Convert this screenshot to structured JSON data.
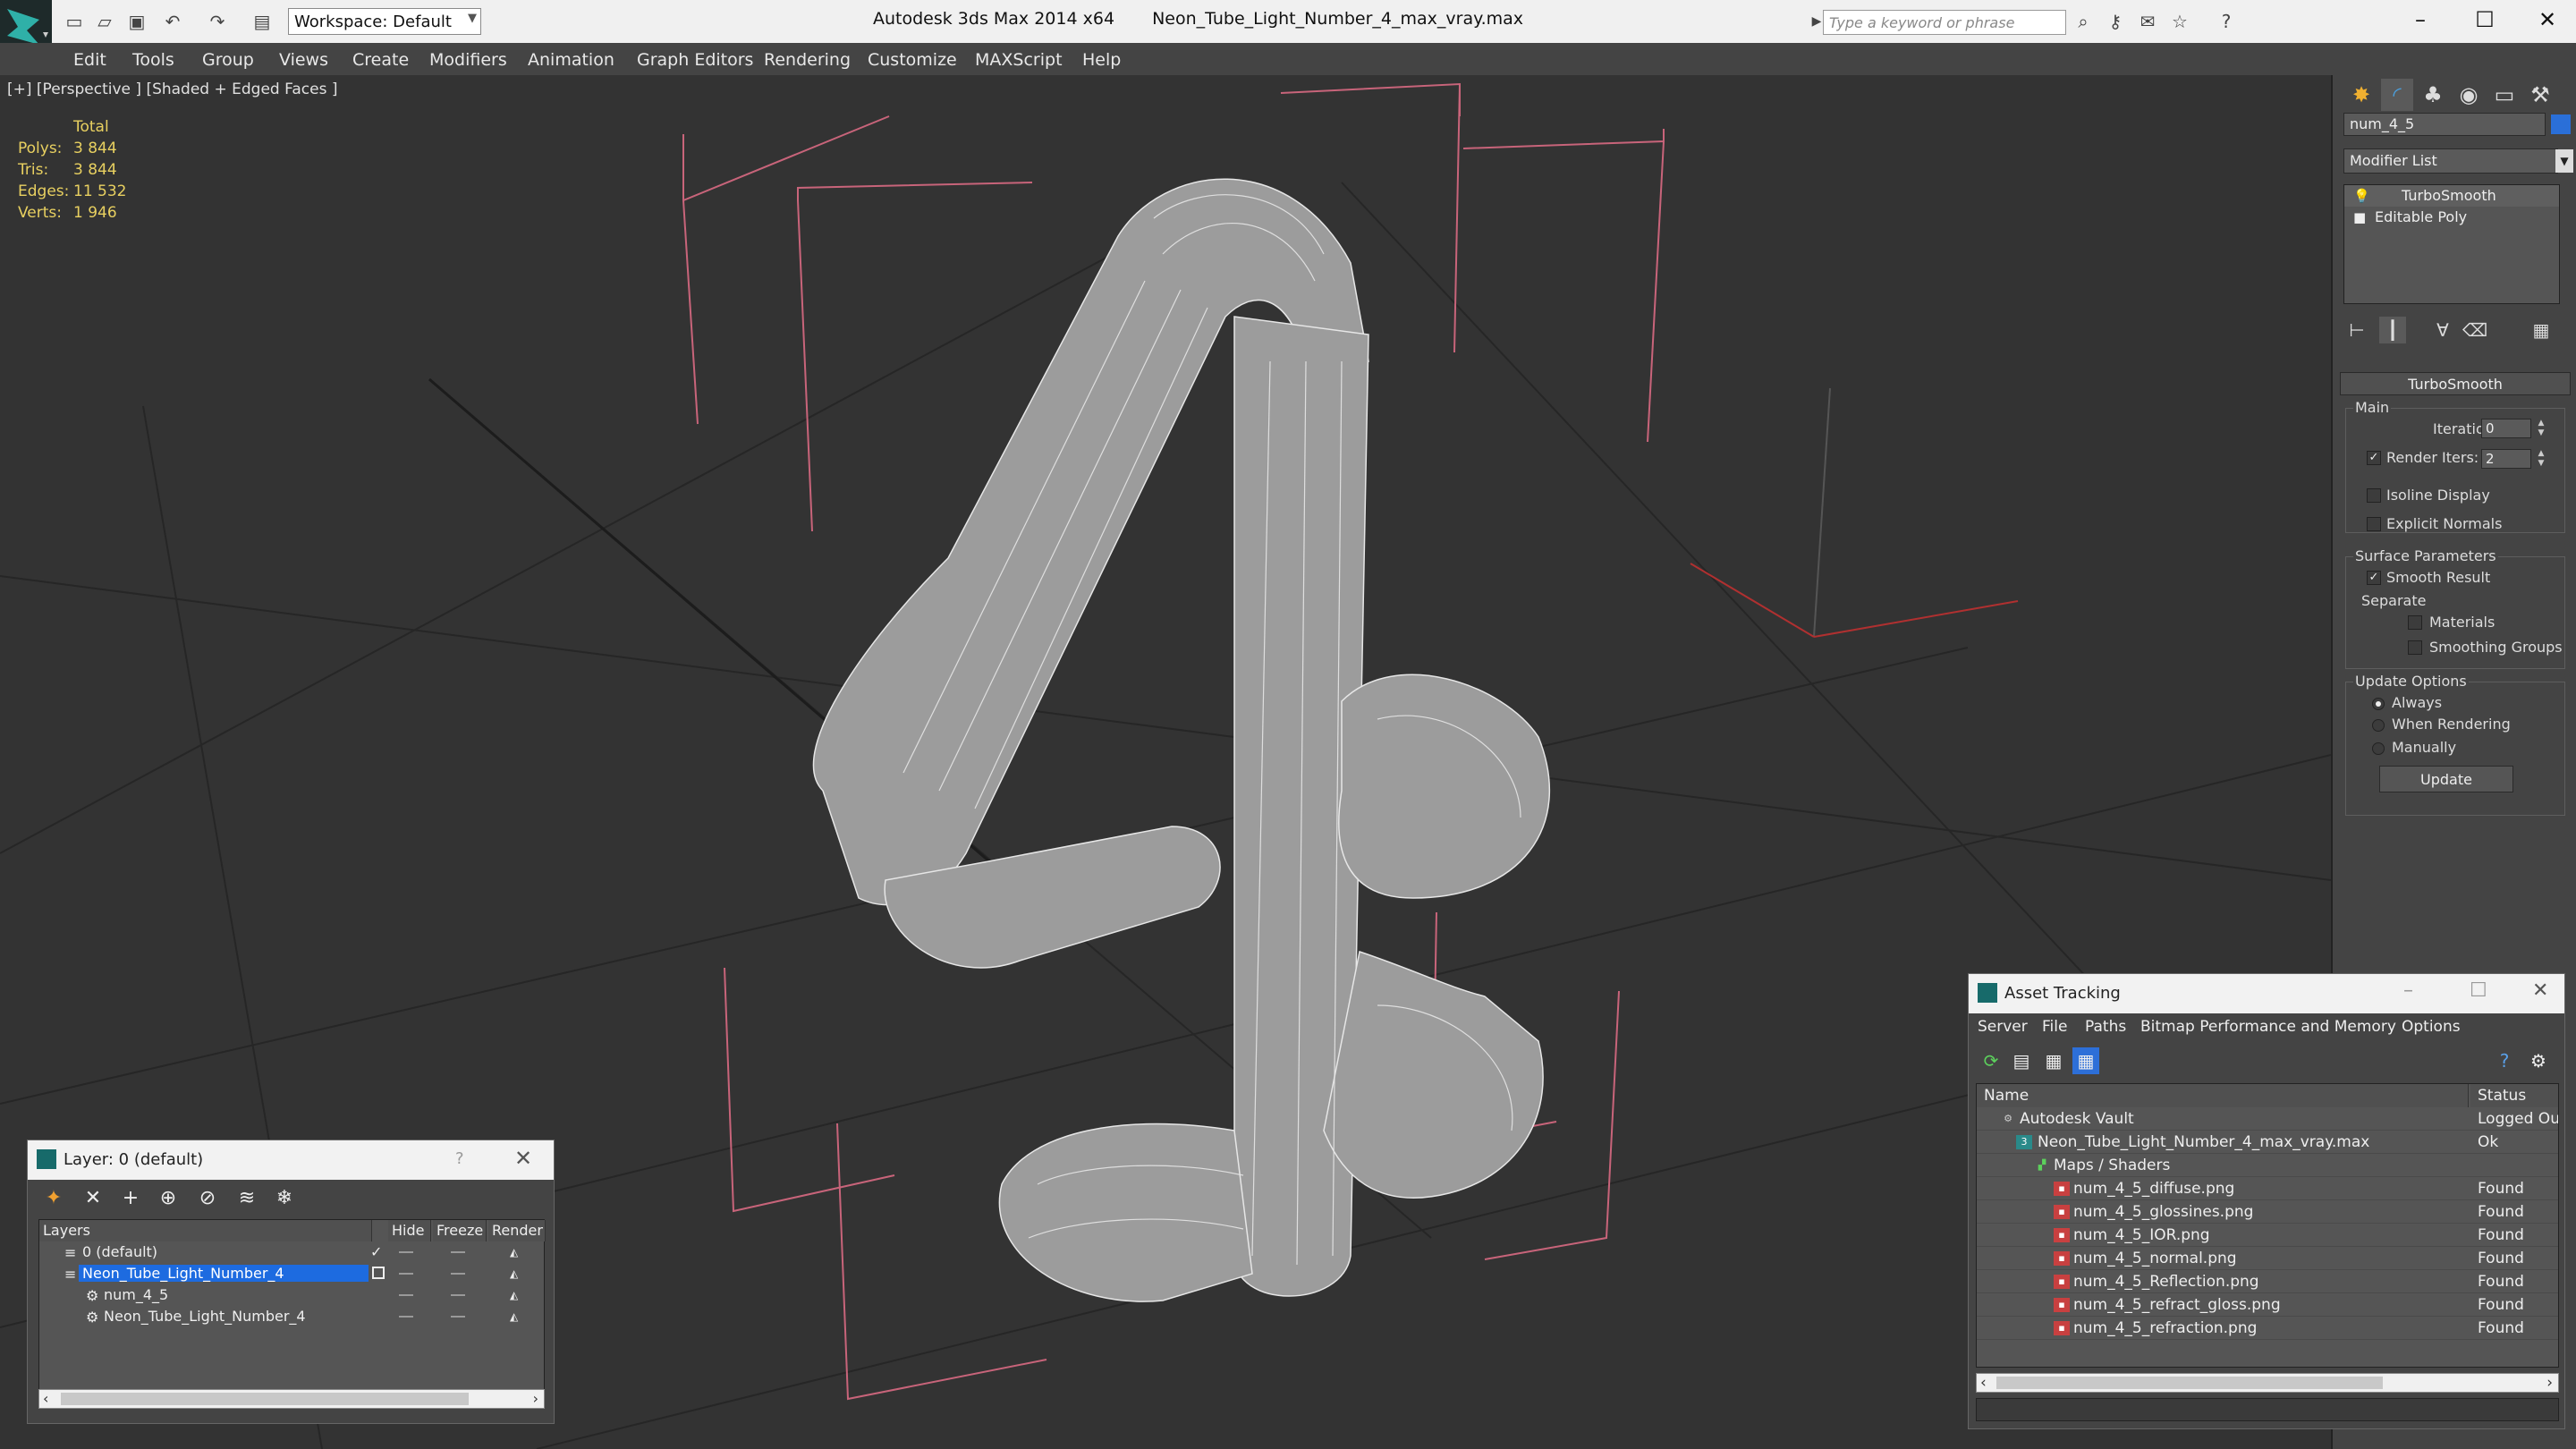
{
  "app": {
    "title": "Autodesk 3ds Max  2014 x64",
    "filename": "Neon_Tube_Light_Number_4_max_vray.max",
    "workspace": "Workspace: Default",
    "search_placeholder": "Type a keyword or phrase"
  },
  "menu": [
    "Edit",
    "Tools",
    "Group",
    "Views",
    "Create",
    "Modifiers",
    "Animation",
    "Graph Editors",
    "Rendering",
    "Customize",
    "MAXScript",
    "Help"
  ],
  "viewport": {
    "label": "[+] [Perspective ] [Shaded + Edged Faces ]",
    "stats": {
      "header": "Total",
      "rows": [
        {
          "k": "Polys:",
          "v": "3 844"
        },
        {
          "k": "Tris:",
          "v": "3 844"
        },
        {
          "k": "Edges:",
          "v": "11 532"
        },
        {
          "k": "Verts:",
          "v": "1 946"
        }
      ]
    }
  },
  "command_panel": {
    "object_name": "num_4_5",
    "object_color": "#2a6fd8",
    "modifier_list": "Modifier List",
    "stack": [
      "TurboSmooth",
      "Editable Poly"
    ],
    "rollout_title": "TurboSmooth",
    "main_label": "Main",
    "iterations_label": "Iterations:",
    "iterations_value": "0",
    "render_iters_label": "Render Iters:",
    "render_iters_value": "2",
    "isoline_label": "Isoline Display",
    "explicit_label": "Explicit Normals",
    "surface_label": "Surface Parameters",
    "smooth_label": "Smooth Result",
    "separate_label": "Separate",
    "materials_label": "Materials",
    "smoothing_groups_label": "Smoothing Groups",
    "update_options_label": "Update Options",
    "always_label": "Always",
    "when_rendering_label": "When Rendering",
    "manually_label": "Manually",
    "update_button": "Update"
  },
  "layer_window": {
    "title": "Layer: 0 (default)",
    "help": "?",
    "columns": [
      "Layers",
      "Hide",
      "Freeze",
      "Render"
    ],
    "rows": [
      "0 (default)",
      "Neon_Tube_Light_Number_4",
      "num_4_5",
      "Neon_Tube_Light_Number_4"
    ]
  },
  "asset_window": {
    "title": "Asset Tracking",
    "menu": [
      "Server",
      "File",
      "Paths",
      "Bitmap Performance and Memory",
      "Options"
    ],
    "columns": [
      "Name",
      "Status"
    ],
    "rows": [
      {
        "name": "Autodesk Vault",
        "status": "Logged Out"
      },
      {
        "name": "Neon_Tube_Light_Number_4_max_vray.max",
        "status": "Ok"
      },
      {
        "name": "Maps / Shaders",
        "status": ""
      },
      {
        "name": "num_4_5_diffuse.png",
        "status": "Found"
      },
      {
        "name": "num_4_5_glossines.png",
        "status": "Found"
      },
      {
        "name": "num_4_5_IOR.png",
        "status": "Found"
      },
      {
        "name": "num_4_5_normal.png",
        "status": "Found"
      },
      {
        "name": "num_4_5_Reflection.png",
        "status": "Found"
      },
      {
        "name": "num_4_5_refract_gloss.png",
        "status": "Found"
      },
      {
        "name": "num_4_5_refraction.png",
        "status": "Found"
      }
    ]
  }
}
